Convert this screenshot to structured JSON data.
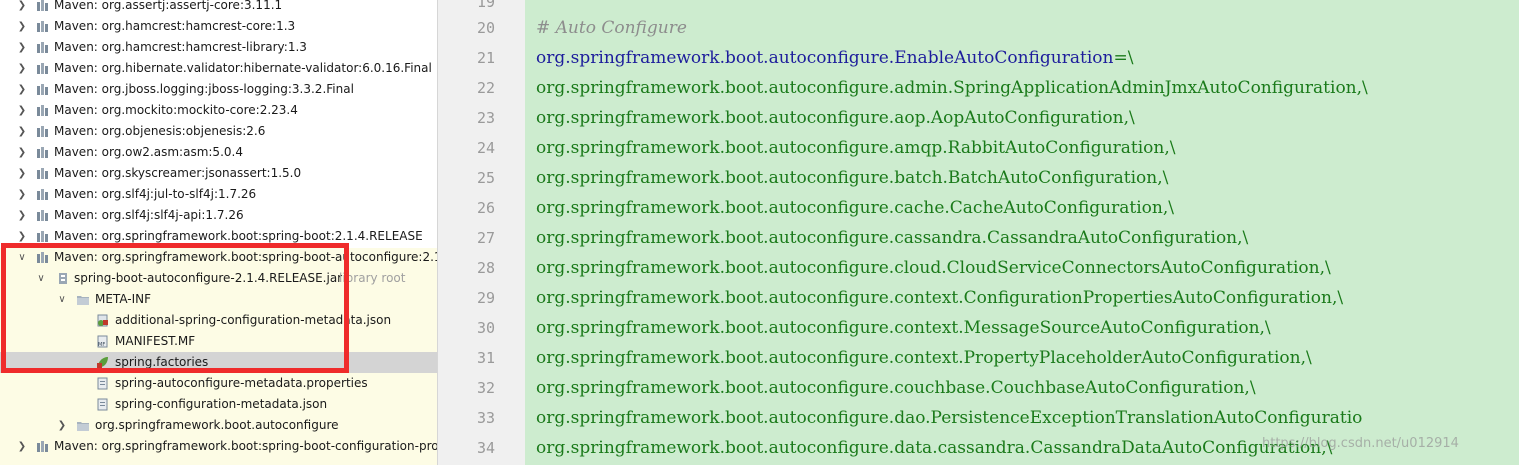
{
  "tree": {
    "rows": [
      {
        "label": "Maven: org.assertj:assertj-core:3.11.1",
        "extra": ""
      },
      {
        "label": "Maven: org.hamcrest:hamcrest-core:1.3",
        "extra": ""
      },
      {
        "label": "Maven: org.hamcrest:hamcrest-library:1.3",
        "extra": ""
      },
      {
        "label": "Maven: org.hibernate.validator:hibernate-validator:6.0.16.Final",
        "extra": ""
      },
      {
        "label": "Maven: org.jboss.logging:jboss-logging:3.3.2.Final",
        "extra": ""
      },
      {
        "label": "Maven: org.mockito:mockito-core:2.23.4",
        "extra": ""
      },
      {
        "label": "Maven: org.objenesis:objenesis:2.6",
        "extra": ""
      },
      {
        "label": "Maven: org.ow2.asm:asm:5.0.4",
        "extra": ""
      },
      {
        "label": "Maven: org.skyscreamer:jsonassert:1.5.0",
        "extra": ""
      },
      {
        "label": "Maven: org.slf4j:jul-to-slf4j:1.7.26",
        "extra": ""
      },
      {
        "label": "Maven: org.slf4j:slf4j-api:1.7.26",
        "extra": ""
      },
      {
        "label": "Maven: org.springframework.boot:spring-boot:2.1.4.RELEASE",
        "extra": ""
      },
      {
        "label": "Maven: org.springframework.boot:spring-boot-autoconfigure:2.1.",
        "extra": ""
      },
      {
        "label": "spring-boot-autoconfigure-2.1.4.RELEASE.jar",
        "extra": "library root"
      },
      {
        "label": "META-INF",
        "extra": ""
      },
      {
        "label": "additional-spring-configuration-metadata.json",
        "extra": ""
      },
      {
        "label": "MANIFEST.MF",
        "extra": ""
      },
      {
        "label": "spring.factories",
        "extra": ""
      },
      {
        "label": "spring-autoconfigure-metadata.properties",
        "extra": ""
      },
      {
        "label": "spring-configuration-metadata.json",
        "extra": ""
      },
      {
        "label": "org.springframework.boot.autoconfigure",
        "extra": ""
      },
      {
        "label": "Maven: org.springframework.boot:spring-boot-configuration-pro",
        "extra": ""
      }
    ]
  },
  "editor": {
    "line_numbers": [
      "19",
      "20",
      "21",
      "22",
      "23",
      "24",
      "25",
      "26",
      "27",
      "28",
      "29",
      "30",
      "31",
      "32",
      "33",
      "34"
    ],
    "lines": [
      {
        "key": "",
        "val": ""
      },
      {
        "key": "",
        "val": "# Auto Configure"
      },
      {
        "key": "org.springframework.boot.autoconfigure.EnableAutoConfiguration",
        "val": "=\\"
      },
      {
        "key": "",
        "val": "org.springframework.boot.autoconfigure.admin.SpringApplicationAdminJmxAutoConfiguration,\\"
      },
      {
        "key": "",
        "val": "org.springframework.boot.autoconfigure.aop.AopAutoConfiguration,\\"
      },
      {
        "key": "",
        "val": "org.springframework.boot.autoconfigure.amqp.RabbitAutoConfiguration,\\"
      },
      {
        "key": "",
        "val": "org.springframework.boot.autoconfigure.batch.BatchAutoConfiguration,\\"
      },
      {
        "key": "",
        "val": "org.springframework.boot.autoconfigure.cache.CacheAutoConfiguration,\\"
      },
      {
        "key": "",
        "val": "org.springframework.boot.autoconfigure.cassandra.CassandraAutoConfiguration,\\"
      },
      {
        "key": "",
        "val": "org.springframework.boot.autoconfigure.cloud.CloudServiceConnectorsAutoConfiguration,\\"
      },
      {
        "key": "",
        "val": "org.springframework.boot.autoconfigure.context.ConfigurationPropertiesAutoConfiguration,\\"
      },
      {
        "key": "",
        "val": "org.springframework.boot.autoconfigure.context.MessageSourceAutoConfiguration,\\"
      },
      {
        "key": "",
        "val": "org.springframework.boot.autoconfigure.context.PropertyPlaceholderAutoConfiguration,\\"
      },
      {
        "key": "",
        "val": "org.springframework.boot.autoconfigure.couchbase.CouchbaseAutoConfiguration,\\"
      },
      {
        "key": "",
        "val": "org.springframework.boot.autoconfigure.dao.PersistenceExceptionTranslationAutoConfiguratio"
      },
      {
        "key": "",
        "val": "org.springframework.boot.autoconfigure.data.cassandra.CassandraDataAutoConfiguration,\\"
      }
    ]
  },
  "watermark": "https://blog.csdn.net/u012914",
  "colors": {
    "highlight_box": "#ef2b2b",
    "editor_bg": "#cdeccf",
    "key": "#1d1d9c",
    "value": "#1a7a1a"
  }
}
